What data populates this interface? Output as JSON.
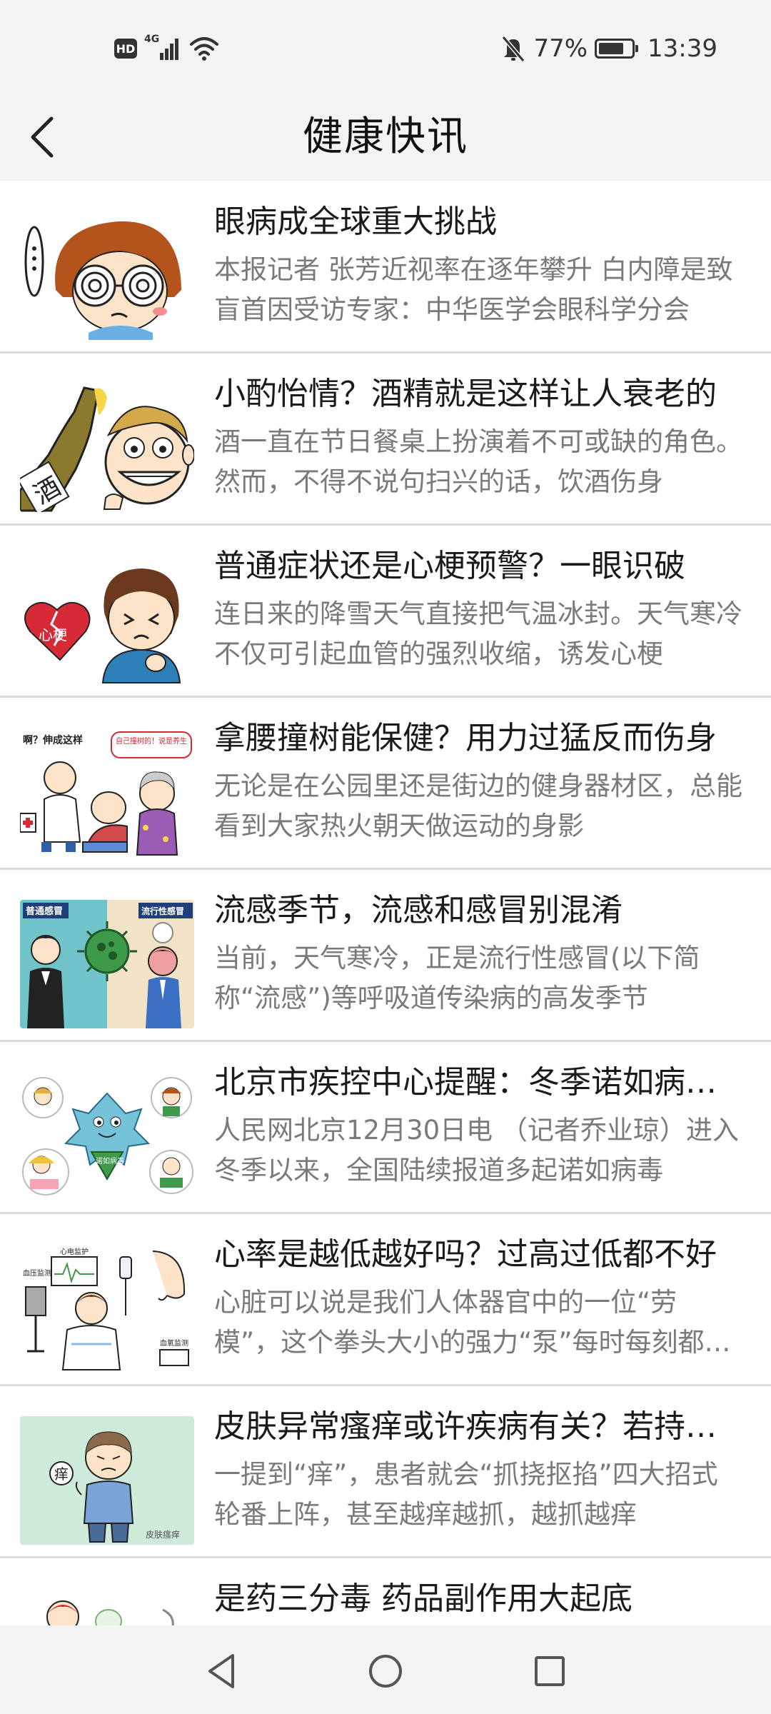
{
  "status_bar": {
    "hd_label": "HD",
    "network": "4G",
    "battery_percent": "77%",
    "battery_level": 0.77,
    "time": "13:39",
    "icons": [
      "hd-icon",
      "signal-icon",
      "wifi-icon",
      "mute-bell-icon",
      "battery-icon"
    ]
  },
  "header": {
    "title": "健康快讯",
    "back_icon": "chevron-left-icon"
  },
  "news": [
    {
      "title": "眼病成全球重大挑战",
      "summary": "本报记者 张芳近视率在逐年攀升 白内障是致盲首因受访专家：中华医学会眼科学分会"
    },
    {
      "title": "小酌怡情？酒精就是这样让人衰老的",
      "summary": "酒一直在节日餐桌上扮演着不可或缺的角色。然而，不得不说句扫兴的话，饮酒伤身"
    },
    {
      "title": "普通症状还是心梗预警？一眼识破",
      "summary": "连日来的降雪天气直接把气温冰封。天气寒冷不仅可引起血管的强烈收缩，诱发心梗"
    },
    {
      "title": "拿腰撞树能保健？用力过猛反而伤身",
      "summary": "无论是在公园里还是街边的健身器材区，总能看到大家热火朝天做运动的身影"
    },
    {
      "title": "流感季节，流感和感冒别混淆",
      "summary": "当前，天气寒冷，正是流行性感冒(以下简称“流感”)等呼吸道传染病的高发季节"
    },
    {
      "title": "北京市疾控中心提醒：冬季诺如病毒高发",
      "summary": "人民网北京12月30日电 （记者乔业琼）进入冬季以来，全国陆续报道多起诺如病毒"
    },
    {
      "title": "心率是越低越好吗？过高过低都不好",
      "summary": "心脏可以说是我们人体器官中的一位“劳模”，这个拳头大小的强力“泵”每时每刻都在工作"
    },
    {
      "title": "皮肤异常瘙痒或许疾病有关？若持续需就医",
      "summary": "一提到“痒”，患者就会“抓挠抠掐”四大招式轮番上阵，甚至越痒越抓，越抓越痒"
    },
    {
      "title": "是药三分毒 药品副作用大起底",
      "summary": ""
    }
  ],
  "thumb_text": {
    "alcohol": "酒",
    "heart": "心梗",
    "massage_left": "啊？伸成这样",
    "massage_right": "自己撞树的！说是养生",
    "flu_left": "普通感冒",
    "flu_right": "流行性感冒",
    "virus": "诺如病毒",
    "monitor_top": "心电监护",
    "monitor_left": "血压监测",
    "monitor_right": "血氧监测",
    "itch_bubble": "痒",
    "itch_caption": "皮肤瘙痒"
  },
  "nav_bar": {
    "icons": [
      "back-triangle-icon",
      "home-circle-icon",
      "recents-square-icon"
    ]
  },
  "colors": {
    "background": "#ffffff",
    "bar_background": "#f4f4f4",
    "title_text": "#1a1a1a",
    "summary_text": "#7a7a7a",
    "divider": "#dcdcdc",
    "heart_red": "#d62b36",
    "thumb_green": "#cdebd8"
  }
}
